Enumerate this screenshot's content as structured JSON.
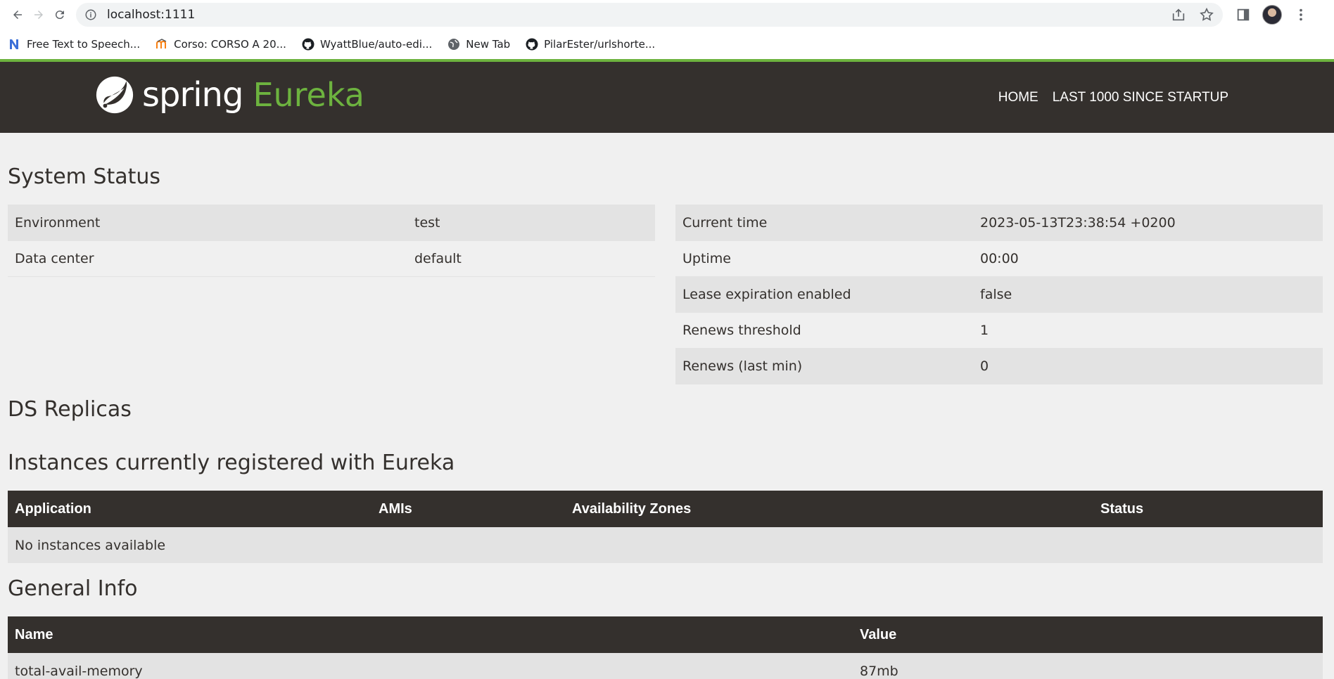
{
  "browser": {
    "url": "localhost:1111",
    "bookmarks": [
      {
        "label": "Free Text to Speech...",
        "icon": "n-logo-icon"
      },
      {
        "label": "Corso: CORSO A 20...",
        "icon": "moodle-icon"
      },
      {
        "label": "WyattBlue/auto-edi...",
        "icon": "github-icon"
      },
      {
        "label": "New Tab",
        "icon": "globe-icon"
      },
      {
        "label": "PilarEster/urlshorte...",
        "icon": "github-icon"
      }
    ]
  },
  "navbar": {
    "logo_spring": "spring",
    "logo_eureka": "Eureka",
    "links": [
      "HOME",
      "LAST 1000 SINCE STARTUP"
    ]
  },
  "system_status": {
    "title": "System Status",
    "left": [
      {
        "key": "Environment",
        "value": "test"
      },
      {
        "key": "Data center",
        "value": "default"
      }
    ],
    "right": [
      {
        "key": "Current time",
        "value": "2023-05-13T23:38:54 +0200"
      },
      {
        "key": "Uptime",
        "value": "00:00"
      },
      {
        "key": "Lease expiration enabled",
        "value": "false"
      },
      {
        "key": "Renews threshold",
        "value": "1"
      },
      {
        "key": "Renews (last min)",
        "value": "0"
      }
    ]
  },
  "ds_replicas": {
    "title": "DS Replicas"
  },
  "instances": {
    "title": "Instances currently registered with Eureka",
    "columns": [
      "Application",
      "AMIs",
      "Availability Zones",
      "Status"
    ],
    "empty_message": "No instances available"
  },
  "general_info": {
    "title": "General Info",
    "columns": [
      "Name",
      "Value"
    ],
    "rows": [
      {
        "name": "total-avail-memory",
        "value": "87mb"
      }
    ]
  },
  "colors": {
    "brand_green": "#6db33f",
    "navbar_bg": "#34302d",
    "page_bg": "#f0f0f0",
    "stripe": "#e3e3e3"
  }
}
